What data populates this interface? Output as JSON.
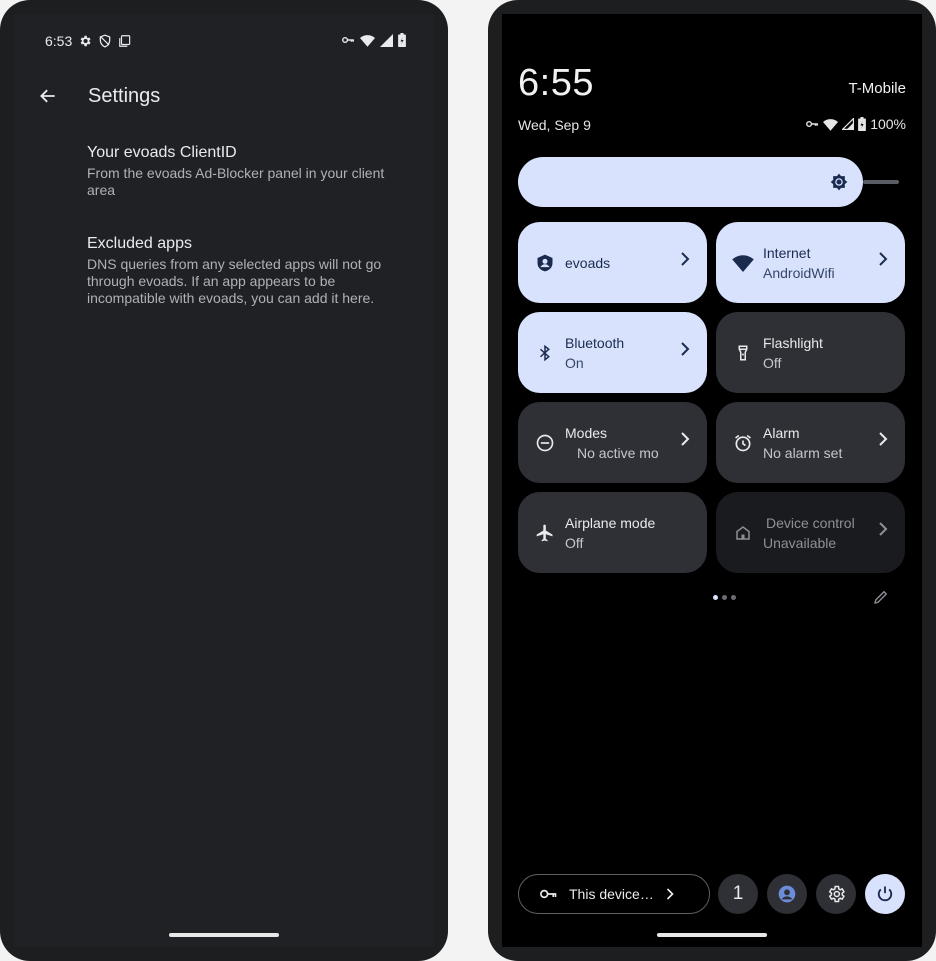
{
  "left": {
    "status_bar": {
      "time": "6:53"
    },
    "settings": {
      "title": "Settings",
      "items": [
        {
          "title": "Your evoads ClientID",
          "summary": "From the evoads Ad-Blocker panel in your client area"
        },
        {
          "title": "Excluded apps",
          "summary": "DNS queries from any selected apps will not go through evoads. If an app appears to be incompatible with evoads, you can add it here."
        }
      ]
    }
  },
  "right": {
    "clock": "6:55",
    "carrier": "T-Mobile",
    "date": "Wed, Sep 9",
    "battery_percent": "100%",
    "brightness_level": 0.89,
    "tiles": [
      {
        "label": "evoads",
        "sub": "",
        "state": "on",
        "icon": "vpn-shield-icon",
        "chevron": true
      },
      {
        "label": "Internet",
        "sub": "AndroidWifi",
        "state": "on",
        "icon": "wifi-icon",
        "chevron": true
      },
      {
        "label": "Bluetooth",
        "sub": "On",
        "state": "on",
        "icon": "bluetooth-icon",
        "chevron": true
      },
      {
        "label": "Flashlight",
        "sub": "Off",
        "state": "off",
        "icon": "flashlight-icon",
        "chevron": false
      },
      {
        "label": "Modes",
        "sub": "No active mo",
        "state": "off",
        "icon": "do-not-disturb-icon",
        "chevron": true
      },
      {
        "label": "Alarm",
        "sub": "No alarm set",
        "state": "off",
        "icon": "alarm-clock-icon",
        "chevron": true
      },
      {
        "label": "Airplane mode",
        "sub": "Off",
        "state": "off",
        "icon": "airplane-icon",
        "chevron": false
      },
      {
        "label": "Device control",
        "sub": "Unavailable",
        "state": "unavailable",
        "icon": "home-icon",
        "chevron": true
      }
    ],
    "pager": {
      "pages": 3,
      "active": 0
    },
    "footer": {
      "device_label": "This device is managed by your organization",
      "user_count": "1"
    },
    "colors": {
      "tile_on": "#d9e2fd",
      "tile_off": "#2e3035",
      "tile_disabled": "#1a1b1e"
    }
  }
}
